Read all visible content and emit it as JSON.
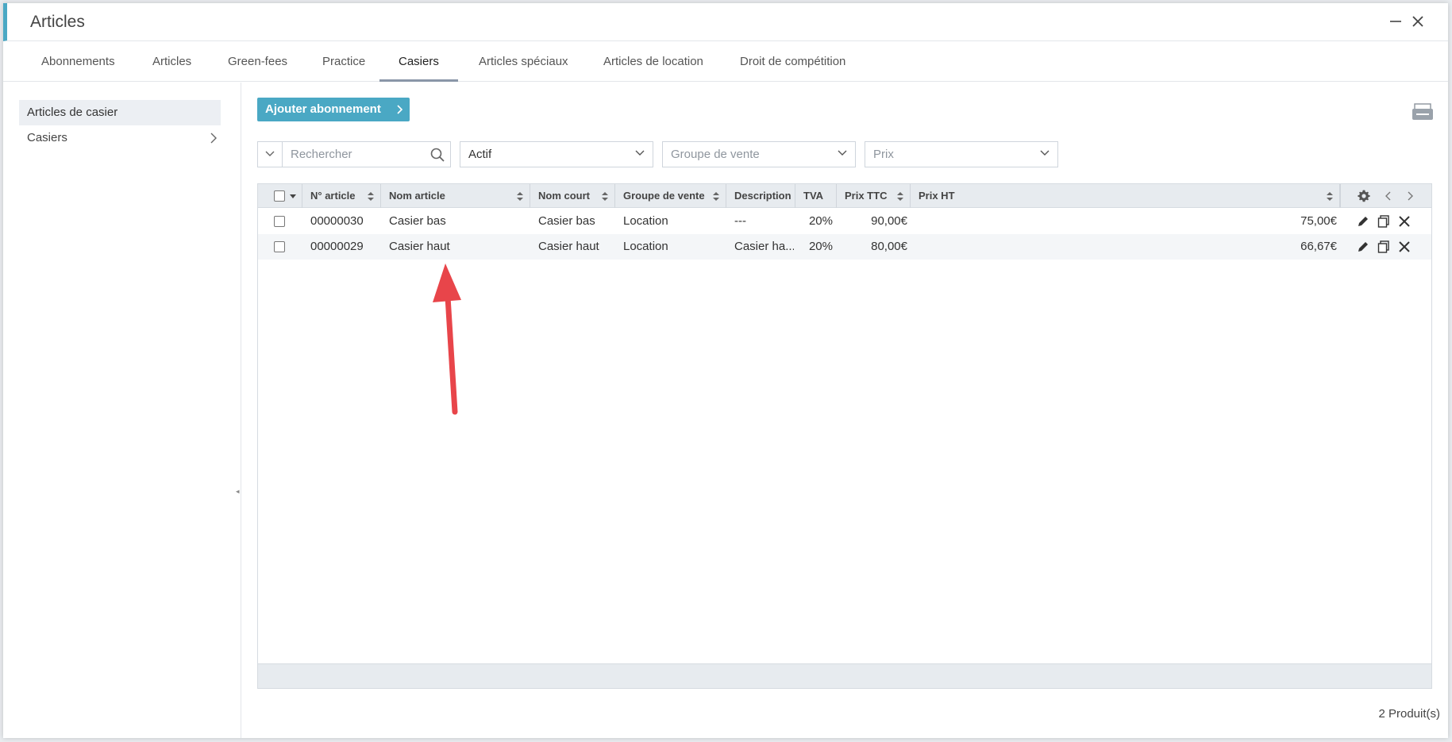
{
  "window": {
    "title": "Articles"
  },
  "tabs": [
    {
      "label": "Abonnements"
    },
    {
      "label": "Articles"
    },
    {
      "label": "Green-fees"
    },
    {
      "label": "Practice"
    },
    {
      "label": "Casiers"
    },
    {
      "label": "Articles spéciaux"
    },
    {
      "label": "Articles de location"
    },
    {
      "label": "Droit de compétition"
    }
  ],
  "active_tab": "Casiers",
  "sidebar": {
    "items": [
      {
        "label": "Articles de casier"
      },
      {
        "label": "Casiers"
      }
    ]
  },
  "toolbar": {
    "add_label": "Ajouter abonnement"
  },
  "filters": {
    "search_placeholder": "Rechercher",
    "status_value": "Actif",
    "group_placeholder": "Groupe de vente",
    "price_placeholder": "Prix"
  },
  "table": {
    "columns": [
      "N° article",
      "Nom article",
      "Nom court",
      "Groupe de vente",
      "Description",
      "TVA",
      "Prix TTC",
      "Prix HT"
    ],
    "rows": [
      [
        "00000030",
        "Casier bas",
        "Casier bas",
        "Location",
        "---",
        "20%",
        "90,00€",
        "75,00€"
      ],
      [
        "00000029",
        "Casier haut",
        "Casier haut",
        "Location",
        "Casier ha...",
        "20%",
        "80,00€",
        "66,67€"
      ]
    ]
  },
  "footer": {
    "count": "2 Produit(s)"
  },
  "colors": {
    "accent": "#4aa8c4",
    "annotation_arrow": "#e8454a"
  },
  "icons": [
    "minimize-icon",
    "close-icon",
    "chevron-right-icon",
    "print-icon",
    "search-icon",
    "chevron-down-icon",
    "sort-icon",
    "gear-icon",
    "edit-icon",
    "copy-icon",
    "delete-icon"
  ]
}
